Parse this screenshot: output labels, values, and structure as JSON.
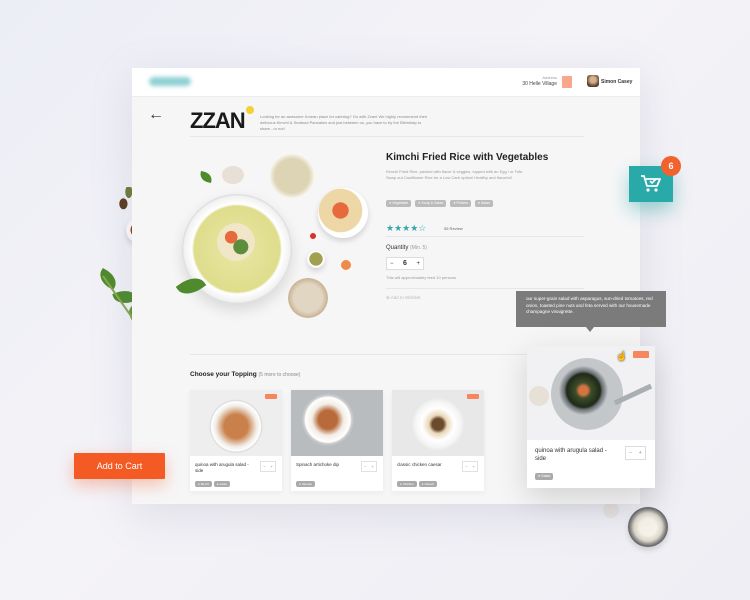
{
  "header": {
    "address_label": "Address",
    "address_value": "30 Helle Village",
    "user_name": "Simon Casey"
  },
  "brand": "ZZAN",
  "intro_text": "Looking for an awesome Korean place for catering? Go with Zzan! We highly recommend their delicious Kimchi & Seafood Pancakes and just between us, you have to try the Bibimbap to share...or not!",
  "product": {
    "title": "Kimchi Fried Rice with Vegetables",
    "description": "Kimchi Fried Rice, packed with flavor & veggies, topped with an Egg / or Tofu. Swap out Cauliflower Rice for a Low Carb option! Healthy and flavorful!",
    "tags": [
      "Vegetable",
      "Soup & Salad",
      "Protein",
      "Asian"
    ],
    "rating": "★★★★☆",
    "reviews": "55 Review",
    "quantity_label": "Quantity",
    "quantity_min": "(Min. 5)",
    "quantity_value": "6",
    "feeds_text": "This will approximately feed 10 persons",
    "wishlist": "Add to Wishlist"
  },
  "toppings": {
    "title": "Choose your Topping",
    "subtitle": "(5 more to choose)",
    "items": [
      {
        "name": "quinoa with arugula salad - side",
        "tags": [
          "Be Fit",
          "Asian"
        ]
      },
      {
        "name": "Spinach artichoke dip",
        "tags": [
          "Sample"
        ]
      },
      {
        "name": "classic chicken caesar",
        "tags": [
          "Chicken",
          "Classic"
        ]
      }
    ]
  },
  "cart": {
    "badge_count": "6"
  },
  "add_to_cart": "Add to Cart",
  "tooltip": "our super-grain salad with asparagus, sun-dried tomatoes, red onion, toasted pine nuts and feta served with our housemade champagne vinaigrette.",
  "featured": {
    "name": "quinoa with arugula salad - side",
    "tag": "Salad"
  },
  "stepper": {
    "minus": "−",
    "plus": "+"
  },
  "colors": {
    "accent": "#2aa9a9",
    "cta": "#f45a24",
    "star": "#35a9a8"
  }
}
